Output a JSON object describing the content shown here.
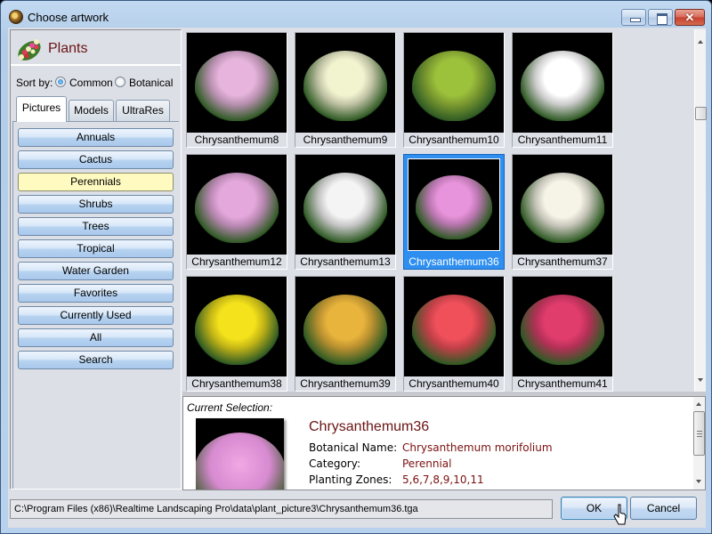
{
  "window": {
    "title": "Choose artwork",
    "controls": {
      "minimize": "minimize",
      "maximize": "maximize",
      "close": "✕"
    }
  },
  "left_panel": {
    "header_title": "Plants",
    "sort_label": "Sort by:",
    "sort_options": [
      {
        "label": "Common",
        "checked": true
      },
      {
        "label": "Botanical",
        "checked": false
      }
    ],
    "tabs": [
      {
        "label": "Pictures",
        "active": true
      },
      {
        "label": "Models",
        "active": false
      },
      {
        "label": "UltraRes",
        "active": false
      }
    ],
    "categories": [
      {
        "label": "Annuals",
        "selected": false
      },
      {
        "label": "Cactus",
        "selected": false
      },
      {
        "label": "Perennials",
        "selected": true
      },
      {
        "label": "Shrubs",
        "selected": false
      },
      {
        "label": "Trees",
        "selected": false
      },
      {
        "label": "Tropical",
        "selected": false
      },
      {
        "label": "Water Garden",
        "selected": false
      },
      {
        "label": "Favorites",
        "selected": false
      },
      {
        "label": "Currently Used",
        "selected": false
      },
      {
        "label": "All",
        "selected": false
      },
      {
        "label": "Search",
        "selected": false
      }
    ]
  },
  "grid": {
    "items": [
      {
        "name": "Chrysanthemum8",
        "flower": "#e6b4dc",
        "selected": false
      },
      {
        "name": "Chrysanthemum9",
        "flower": "#f2f4d0",
        "selected": false
      },
      {
        "name": "Chrysanthemum10",
        "flower": "#9cc23c",
        "selected": false
      },
      {
        "name": "Chrysanthemum11",
        "flower": "#ffffff",
        "selected": false
      },
      {
        "name": "Chrysanthemum12",
        "flower": "#e4a8dc",
        "selected": false
      },
      {
        "name": "Chrysanthemum13",
        "flower": "#f4f4f4",
        "selected": false
      },
      {
        "name": "Chrysanthemum36",
        "flower": "#e894dc",
        "selected": true
      },
      {
        "name": "Chrysanthemum37",
        "flower": "#f6f4e6",
        "selected": false
      },
      {
        "name": "Chrysanthemum38",
        "flower": "#f4e21c",
        "selected": false
      },
      {
        "name": "Chrysanthemum39",
        "flower": "#e8b43c",
        "selected": false
      },
      {
        "name": "Chrysanthemum40",
        "flower": "#f0505a",
        "selected": false
      },
      {
        "name": "Chrysanthemum41",
        "flower": "#e03c6c",
        "selected": false
      }
    ]
  },
  "detail": {
    "heading": "Current Selection:",
    "name": "Chrysanthemum36",
    "fields": [
      {
        "label": "Botanical Name:",
        "value": "Chrysanthemum morifolium"
      },
      {
        "label": "Category:",
        "value": "Perennial"
      },
      {
        "label": "Planting Zones:",
        "value": "5,6,7,8,9,10,11"
      }
    ]
  },
  "footer": {
    "path": "C:\\Program Files (x86)\\Realtime Landscaping Pro\\data\\plant_picture3\\Chrysanthemum36.tga",
    "ok_label": "OK",
    "cancel_label": "Cancel"
  }
}
